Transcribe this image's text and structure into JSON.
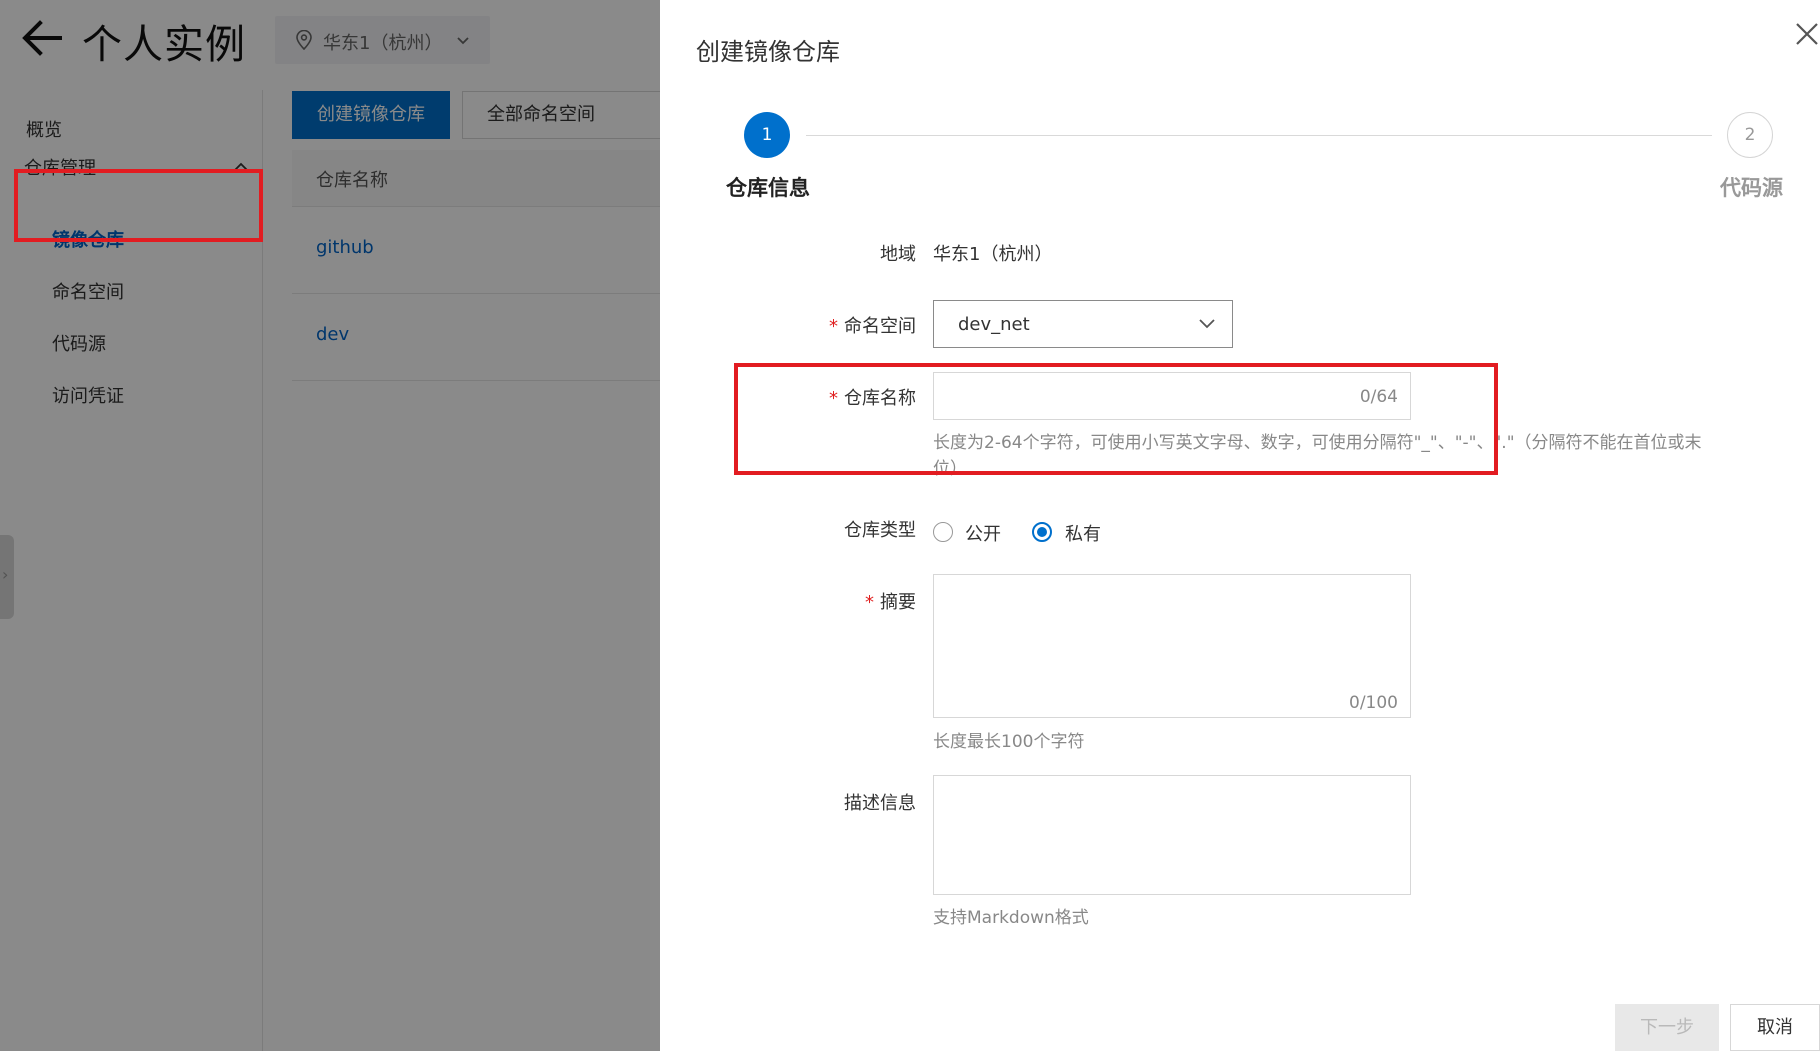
{
  "header": {
    "title": "个人实例",
    "region": "华东1（杭州）"
  },
  "sidebar": {
    "overview": "概览",
    "group_label": "仓库管理",
    "items": [
      {
        "label": "镜像仓库",
        "active": true
      },
      {
        "label": "命名空间",
        "active": false
      },
      {
        "label": "代码源",
        "active": false
      },
      {
        "label": "访问凭证",
        "active": false
      }
    ]
  },
  "main": {
    "create_button": "创建镜像仓库",
    "namespace_filter": "全部命名空间",
    "table_header": "仓库名称",
    "rows": [
      "github",
      "dev"
    ]
  },
  "drawer": {
    "title": "创建镜像仓库",
    "steps": [
      {
        "number": "1",
        "label": "仓库信息",
        "active": true
      },
      {
        "number": "2",
        "label": "代码源",
        "active": false
      }
    ],
    "form": {
      "region_label": "地域",
      "region_value": "华东1（杭州）",
      "namespace_label": "命名空间",
      "namespace_value": "dev_net",
      "repo_name_label": "仓库名称",
      "repo_name_value": "",
      "repo_name_counter": "0/64",
      "repo_name_hint_line1": "长度为2-64个字符，可使用小写英文字母、数字，可使用分隔符\"_\"、\"-\"、\".\"（分隔符不能在首位或末",
      "repo_name_hint_line2": "位）",
      "repo_type_label": "仓库类型",
      "repo_type_options": [
        {
          "label": "公开",
          "selected": false
        },
        {
          "label": "私有",
          "selected": true
        }
      ],
      "summary_label": "摘要",
      "summary_counter": "0/100",
      "summary_hint": "长度最长100个字符",
      "description_label": "描述信息",
      "description_hint": "支持Markdown格式"
    },
    "buttons": {
      "next": "下一步",
      "cancel": "取消"
    }
  },
  "colors": {
    "primary": "#0070cc",
    "highlight_box": "#e21c21",
    "required_mark": "#e02020"
  }
}
